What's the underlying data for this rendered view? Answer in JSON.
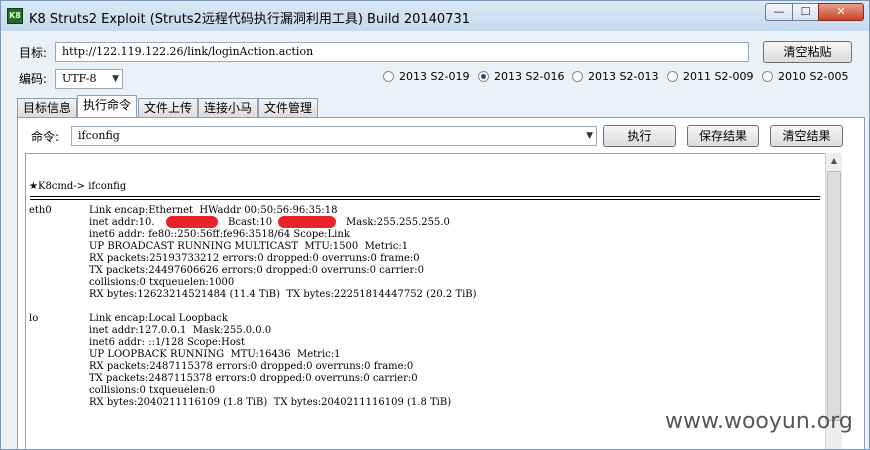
{
  "window": {
    "title": "K8 Struts2 Exploit (Struts2远程代码执行漏洞利用工具) Build 20140731",
    "icon_text": "K8",
    "minimize_glyph": "—",
    "maximize_glyph": "☐",
    "close_glyph": "✕"
  },
  "target": {
    "label": "目标:",
    "url": "http://122.119.122.26/link/loginAction.action",
    "clear_paste_button": "清空粘贴"
  },
  "encoding": {
    "label": "编码:",
    "value": "UTF-8"
  },
  "exploits": [
    {
      "label": "2013 S2-019",
      "checked": false
    },
    {
      "label": "2013 S2-016",
      "checked": true
    },
    {
      "label": "2013 S2-013",
      "checked": false
    },
    {
      "label": "2011 S2-009",
      "checked": false
    },
    {
      "label": "2010 S2-005",
      "checked": false
    }
  ],
  "tabs": [
    {
      "label": "目标信息",
      "active": false
    },
    {
      "label": "执行命令",
      "active": true
    },
    {
      "label": "文件上传",
      "active": false
    },
    {
      "label": "连接小马",
      "active": false
    },
    {
      "label": "文件管理",
      "active": false
    }
  ],
  "command": {
    "label": "命令:",
    "value": "ifconfig",
    "execute_button": "执行",
    "save_button": "保存结果",
    "clear_button": "清空结果"
  },
  "output": {
    "prompt_star": "★",
    "prompt": "K8cmd-> ifconfig",
    "eth0": {
      "iface": "eth0",
      "lines": [
        "Link encap:Ethernet  HWaddr 00:50:56:96:35:18",
        "inet addr:10.",
        "inet6 addr: fe80::250:56ff:fe96:3518/64 Scope:Link",
        "UP BROADCAST RUNNING MULTICAST  MTU:1500  Metric:1",
        "RX packets:25193733212 errors:0 dropped:0 overruns:0 frame:0",
        "TX packets:24497606626 errors:0 dropped:0 overruns:0 carrier:0",
        "collisions:0 txqueuelen:1000",
        "RX bytes:12623214521484 (11.4 TiB)  TX bytes:22251814447752 (20.2 TiB)"
      ],
      "bcast_label": "Bcast:10",
      "mask_label": "Mask:255.255.255.0"
    },
    "lo": {
      "iface": "lo",
      "lines": [
        "Link encap:Local Loopback",
        "inet addr:127.0.0.1  Mask:255.0.0.0",
        "inet6 addr: ::1/128 Scope:Host",
        "UP LOOPBACK RUNNING  MTU:16436  Metric:1",
        "RX packets:2487115378 errors:0 dropped:0 overruns:0 frame:0",
        "TX packets:2487115378 errors:0 dropped:0 overruns:0 carrier:0",
        "collisions:0 txqueuelen:0",
        "RX bytes:2040211116109 (1.8 TiB)  TX bytes:2040211116109 (1.8 TiB)"
      ]
    }
  },
  "watermark": "www.wooyun.org",
  "colors": {
    "redaction": "#e8242a",
    "window_bg": "#eaf2f8",
    "close_button": "#c8412b"
  }
}
